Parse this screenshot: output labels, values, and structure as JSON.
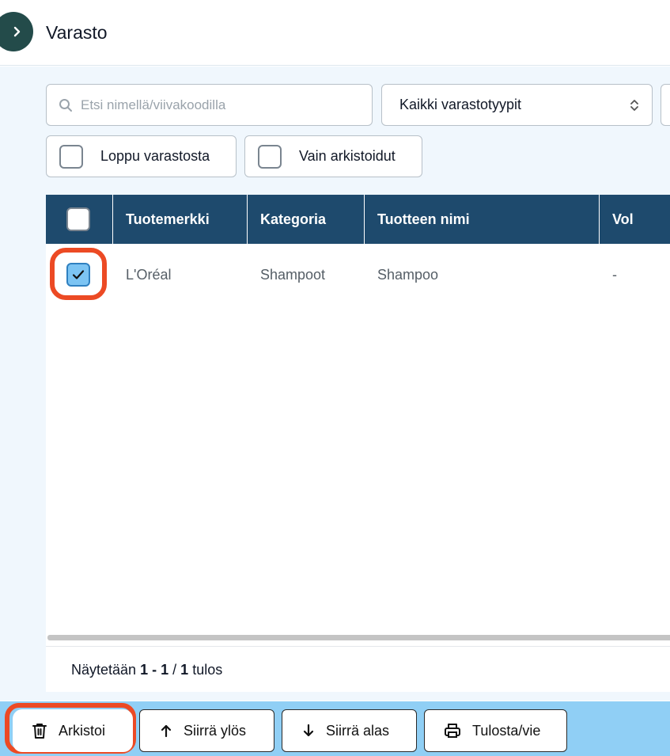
{
  "header": {
    "title": "Varasto",
    "toggle_icon": "chevron-right-icon"
  },
  "filters": {
    "search_placeholder": "Etsi nimellä/viivakoodilla",
    "type_select": "Kaikki varastotyypit",
    "out_of_stock_label": "Loppu varastosta",
    "archived_only_label": "Vain arkistoidut"
  },
  "table": {
    "columns": [
      "Tuotemerkki",
      "Kategoria",
      "Tuotteen nimi",
      "Vol"
    ],
    "rows": [
      {
        "brand": "L'Oréal",
        "category": "Shampoot",
        "name": "Shampoo",
        "vol": "-",
        "checked": true
      }
    ]
  },
  "pagination": {
    "prefix": "Näytetään",
    "range": "1 - 1",
    "total": "1",
    "suffix": "tulos",
    "sep": "/"
  },
  "actions": {
    "archive": "Arkistoi",
    "move_up": "Siirrä ylös",
    "move_down": "Siirrä alas",
    "print_export": "Tulosta/vie"
  },
  "colors": {
    "header_bg": "#1e4a6d",
    "accent_ring": "#ec4a24",
    "action_bar": "#90cff5",
    "toggle_bg": "#234b4a"
  }
}
